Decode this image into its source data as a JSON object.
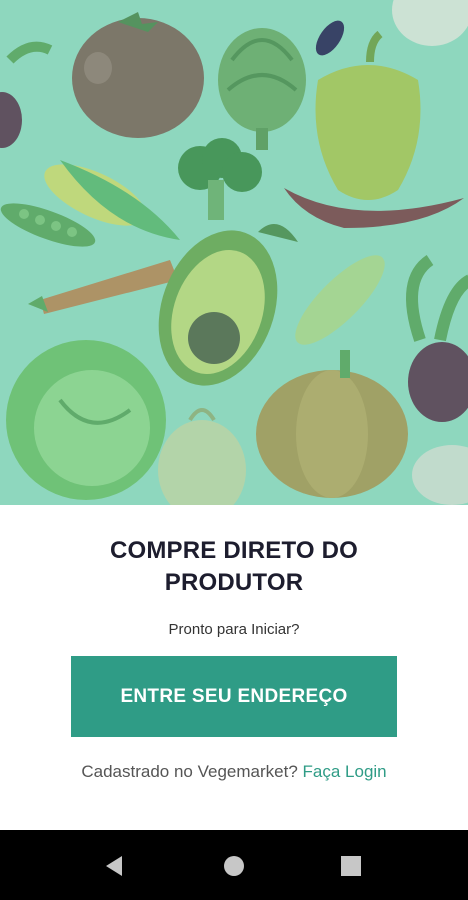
{
  "onboarding": {
    "headline_line1": "COMPRE DIRETO DO",
    "headline_line2": "PRODUTOR",
    "subtitle": "Pronto para Iniciar?",
    "cta_label": "ENTRE SEU ENDEREÇO",
    "login_prompt": "Cadastrado no Vegemarket?",
    "login_link": "Faça Login"
  },
  "hero": {
    "image_name": "vegetables-illustration",
    "background_color": "#8fd8bf"
  },
  "colors": {
    "accent": "#2f9c86",
    "headline": "#1d1d2e",
    "navbar": "#000000"
  },
  "navbar": {
    "back_icon": "back-triangle-icon",
    "home_icon": "home-circle-icon",
    "recents_icon": "recents-square-icon"
  }
}
